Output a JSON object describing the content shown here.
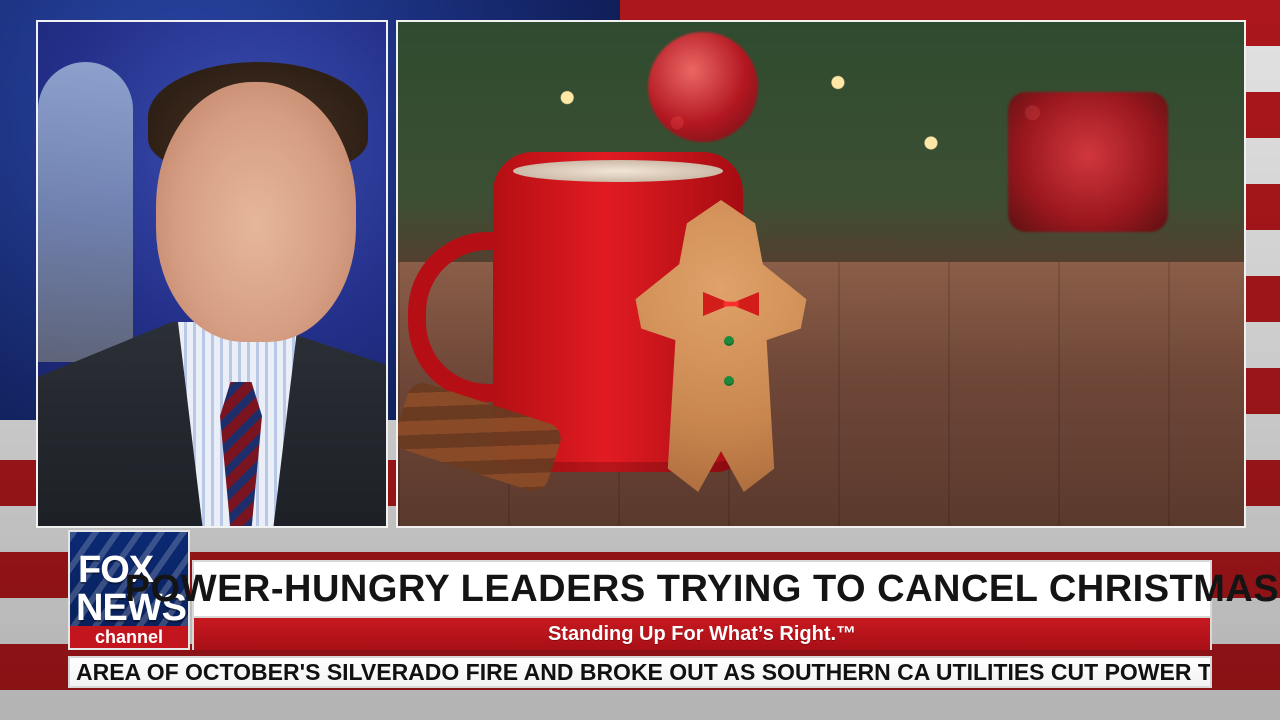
{
  "lower_third": {
    "logo": {
      "brand_top": "FOX",
      "brand_bottom": "NEWS",
      "channel": "channel"
    },
    "headline": "POWER-HUNGRY LEADERS TRYING TO CANCEL CHRISTMAS",
    "tagline": "Standing Up For What’s Right.™",
    "ticker": "AREA OF OCTOBER'S SILVERADO FIRE AND BROKE OUT AS SOUTHERN CA UTILITIES CUT POWER TO AVOID"
  },
  "colors": {
    "fox_red": "#c3151d",
    "fox_blue": "#0b2a74",
    "headline_text": "#141414",
    "ticker_text": "#111111"
  },
  "icons": {
    "logo": "fox-news-channel-logo"
  }
}
